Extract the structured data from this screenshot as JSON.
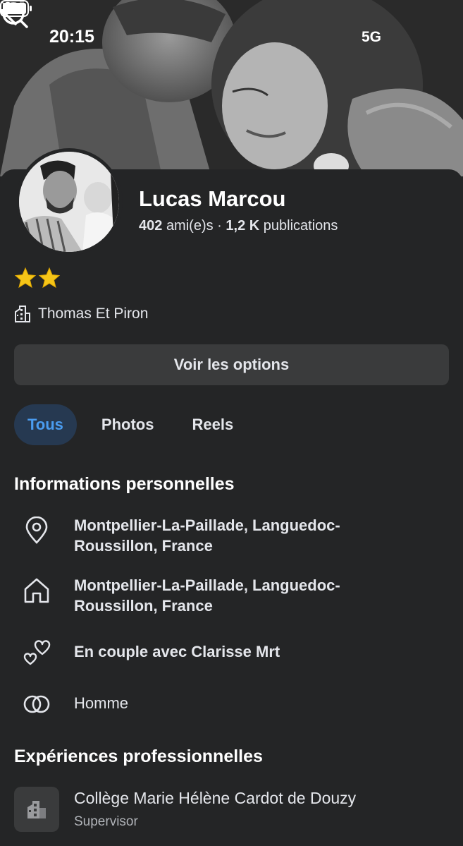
{
  "status_bar": {
    "time": "20:15",
    "network": "5G"
  },
  "profile": {
    "name": "Lucas Marcou",
    "friends_count": "402",
    "friends_label": "ami(e)s",
    "separator": "·",
    "posts_count": "1,2 K",
    "posts_label": "publications",
    "stars_count": 2,
    "workplace": "Thomas Et Piron"
  },
  "actions": {
    "options_label": "Voir les options"
  },
  "tabs": [
    {
      "label": "Tous",
      "active": true
    },
    {
      "label": "Photos",
      "active": false
    },
    {
      "label": "Reels",
      "active": false
    }
  ],
  "personal_info": {
    "title": "Informations personnelles",
    "items": [
      {
        "icon": "location-pin-icon",
        "line1": "Montpellier-La-Paillade, Languedoc-",
        "line2": "Roussillon, France"
      },
      {
        "icon": "home-icon",
        "line1": "Montpellier-La-Paillade, Languedoc-",
        "line2": "Roussillon, France"
      },
      {
        "icon": "hearts-icon",
        "line1": "En couple avec Clarisse Mrt"
      },
      {
        "icon": "gender-rings-icon",
        "line1": "Homme"
      }
    ]
  },
  "experience": {
    "title": "Expériences professionnelles",
    "items": [
      {
        "icon": "building-icon",
        "name": "Collège Marie Hélène Cardot de Douzy",
        "role": "Supervisor"
      }
    ]
  },
  "colors": {
    "background": "#242526",
    "button": "#3a3b3c",
    "tab_active_bg": "#263951",
    "tab_active_text": "#4a9cf0"
  }
}
